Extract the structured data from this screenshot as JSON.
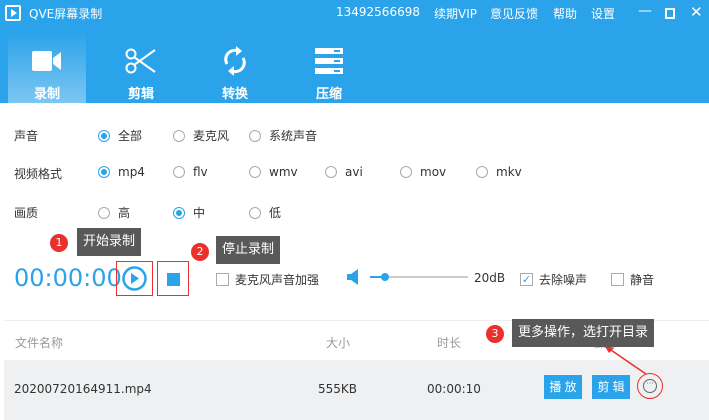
{
  "app": {
    "title": "QVE屏幕录制",
    "account": "13492566698",
    "links": [
      "续期VIP",
      "意见反馈",
      "帮助",
      "设置"
    ]
  },
  "tabs": [
    {
      "label": "录制",
      "icon": "video-camera-icon",
      "active": true
    },
    {
      "label": "剪辑",
      "icon": "scissors-icon"
    },
    {
      "label": "转换",
      "icon": "refresh-icon"
    },
    {
      "label": "压缩",
      "icon": "compress-icon"
    }
  ],
  "settings": {
    "audio": {
      "label": "声音",
      "options": [
        "全部",
        "麦克风",
        "系统声音"
      ],
      "selected": "全部"
    },
    "format": {
      "label": "视频格式",
      "options": [
        "mp4",
        "flv",
        "wmv",
        "avi",
        "mov",
        "mkv"
      ],
      "selected": "mp4"
    },
    "quality": {
      "label": "画质",
      "options": [
        "高",
        "中",
        "低"
      ],
      "selected": "中"
    }
  },
  "recorder": {
    "timer": "00:00:00",
    "mic_boost": "麦克风声音加强",
    "volume": "20dB",
    "volume_level": 0.15,
    "denoise": "去除噪声",
    "denoise_checked": true,
    "mute": "静音",
    "mute_checked": false
  },
  "tips": [
    {
      "n": "1",
      "text": "开始录制"
    },
    {
      "n": "2",
      "text": "停止录制"
    },
    {
      "n": "3",
      "text": "更多操作，选打开目录"
    }
  ],
  "table": {
    "headers": [
      "文件名称",
      "大小",
      "时长",
      "操作"
    ],
    "rows": [
      {
        "name": "20200720164911.mp4",
        "size": "555KB",
        "duration": "00:00:10",
        "play": "播 放",
        "edit": "剪 辑"
      }
    ]
  },
  "colors": {
    "accent": "#2aa3ea",
    "red": "#e8302c"
  }
}
